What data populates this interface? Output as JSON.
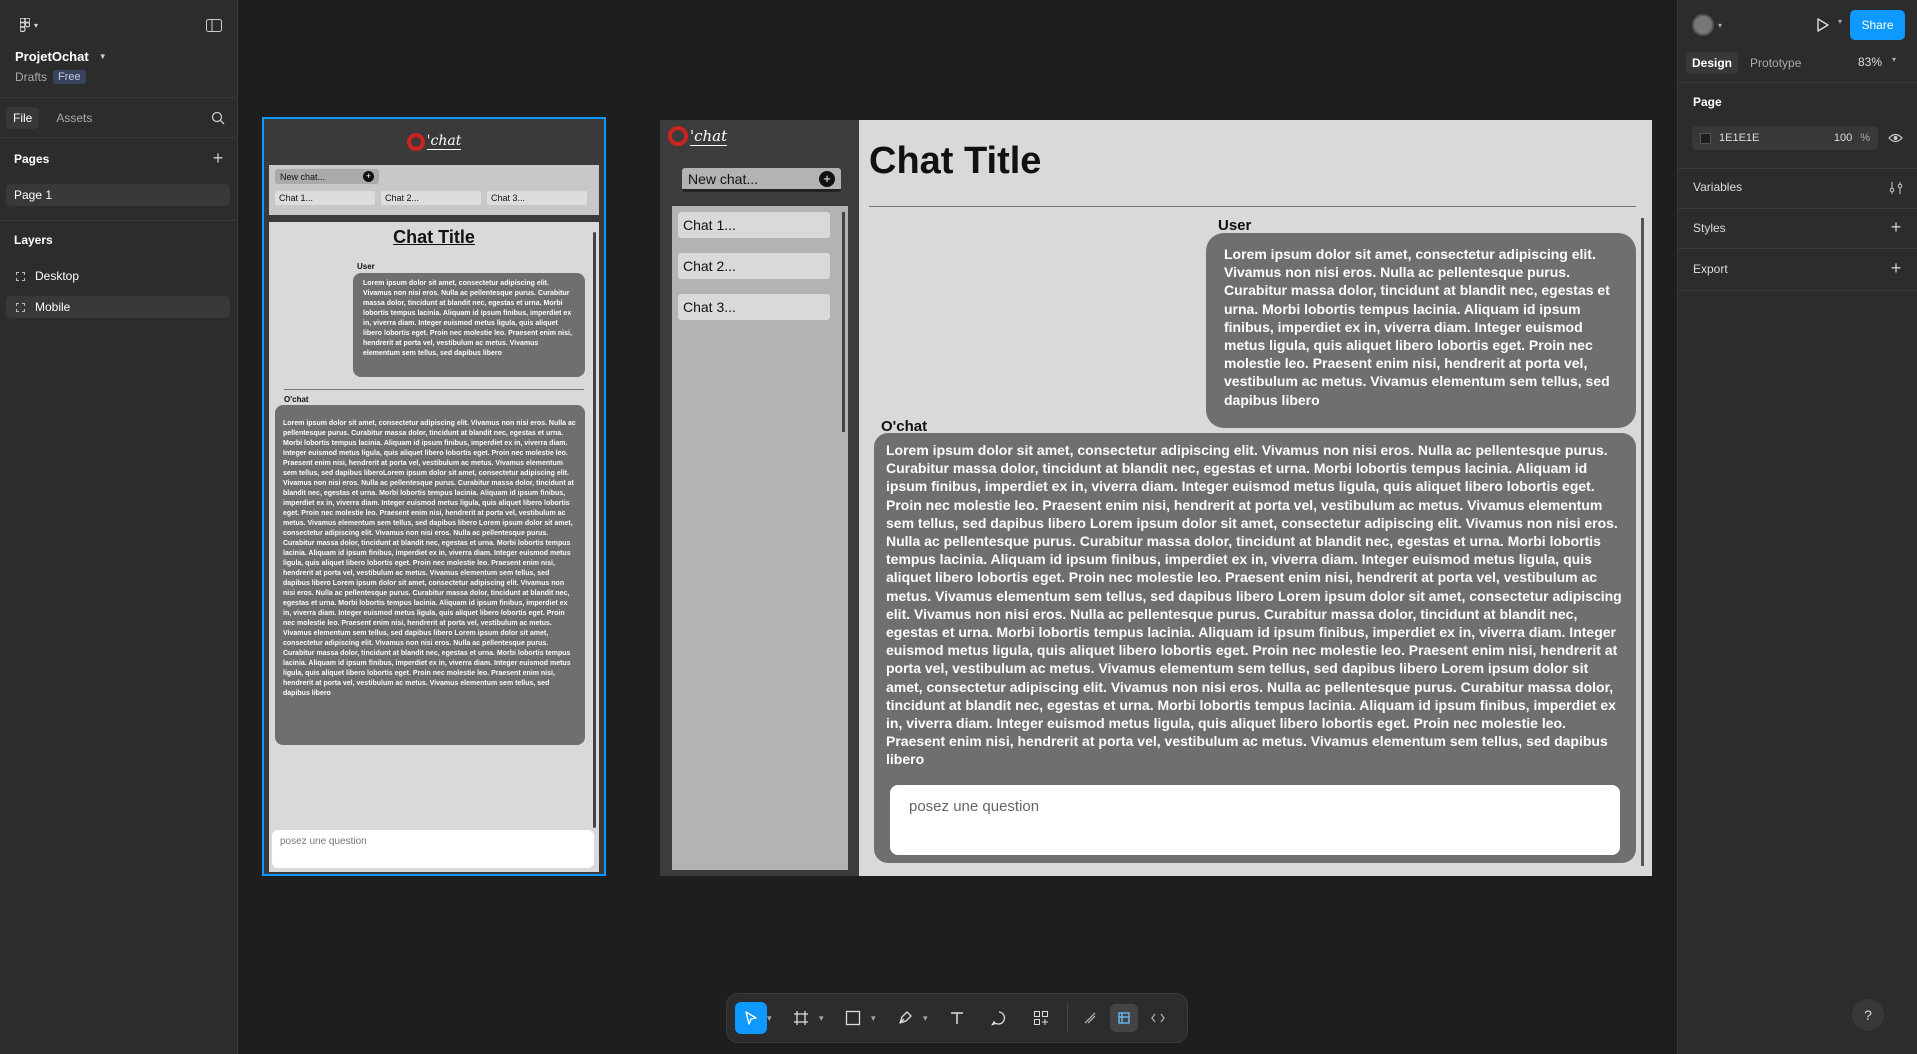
{
  "left_panel": {
    "project_name": "ProjetOchat",
    "drafts_label": "Drafts",
    "plan_badge": "Free",
    "tabs": {
      "file": "File",
      "assets": "Assets"
    },
    "pages_title": "Pages",
    "page_item": "Page 1",
    "layers_title": "Layers",
    "layers": [
      "Desktop",
      "Mobile"
    ]
  },
  "right_panel": {
    "tab_design": "Design",
    "tab_prototype": "Prototype",
    "zoom": "83%",
    "share_label": "Share",
    "page_section": "Page",
    "bg_color_hex": "1E1E1E",
    "bg_opacity": "100",
    "percent": "%",
    "variables": "Variables",
    "styles": "Styles",
    "export": "Export"
  },
  "mobile": {
    "logo_text": "'chat",
    "new_chat": "New chat...",
    "chats": [
      "Chat 1...",
      "Chat 2...",
      "Chat 3..."
    ],
    "chat_title": "Chat Title",
    "user_label": "User",
    "user_msg": "Lorem ipsum dolor sit amet, consectetur adipiscing elit. Vivamus non  nisi eros. Nulla ac pellentesque purus. Curabitur massa dolor, tincidunt at blandit nec, egestas et urna. Morbi lobortis tempus lacinia. Aliquam id ipsum finibus, imperdiet ex in, viverra diam. Integer euismod metus  ligula, quis aliquet libero lobortis eget. Proin nec molestie leo.  Praesent enim nisi, hendrerit at porta vel, vestibulum ac metus. Vivamus elementum sem tellus, sed dapibus libero",
    "bot_label": "O'chat",
    "bot_msg": "Lorem ipsum dolor sit amet, consectetur adipiscing elit. Vivamus non  nisi eros. Nulla ac pellentesque purus. Curabitur massa dolor, tincidunt at blandit nec, egestas et urna. Morbi lobortis tempus lacinia. Aliquam id ipsum finibus, imperdiet ex in, viverra diam. Integer euismod metus  ligula, quis aliquet libero lobortis eget. Proin nec molestie leo.  Praesent enim nisi, hendrerit at porta vel, vestibulum ac metus. Vivamus elementum sem tellus, sed dapibus liberoLorem ipsum dolor sit amet, consectetur adipiscing elit. Vivamus non  nisi eros. Nulla ac pellentesque purus. Curabitur massa dolor, tincidunt at blandit nec, egestas et urna. Morbi lobortis tempus lacinia. Aliquam id ipsum finibus, imperdiet ex in, viverra diam. Integer euismod metus  ligula, quis aliquet libero lobortis eget. Proin nec molestie leo.  Praesent enim nisi, hendrerit at porta vel, vestibulum ac metus. Vivamus elementum sem tellus, sed dapibus libero Lorem ipsum dolor sit amet, consectetur adipiscing elit. Vivamus non  nisi eros. Nulla ac pellentesque purus. Curabitur massa dolor, tincidunt at blandit nec, egestas et urna. Morbi lobortis tempus lacinia. Aliquam id ipsum finibus, imperdiet ex in, viverra diam. Integer euismod metus  ligula, quis aliquet libero lobortis eget. Proin nec molestie leo.  Praesent enim nisi, hendrerit at porta vel, vestibulum ac metus. Vivamus elementum sem tellus, sed dapibus libero Lorem ipsum dolor sit amet, consectetur adipiscing elit. Vivamus non  nisi eros. Nulla ac pellentesque purus. Curabitur massa dolor, tincidunt at blandit nec, egestas et urna. Morbi lobortis tempus lacinia. Aliquam id ipsum finibus, imperdiet ex in, viverra diam. Integer euismod metus  ligula, quis aliquet libero lobortis eget. Proin nec molestie leo.  Praesent enim nisi, hendrerit at porta vel, vestibulum ac metus. Vivamus elementum sem tellus, sed dapibus libero Lorem ipsum dolor sit amet, consectetur adipiscing elit. Vivamus non  nisi eros. Nulla ac pellentesque purus. Curabitur massa dolor, tincidunt at blandit nec, egestas et urna. Morbi lobortis tempus lacinia. Aliquam id ipsum finibus, imperdiet ex in, viverra diam. Integer euismod metus  ligula, quis aliquet libero lobortis eget. Proin nec molestie leo.  Praesent enim nisi, hendrerit at porta vel, vestibulum ac metus. Vivamus elementum sem tellus, sed dapibus libero",
    "input_placeholder": "posez une question"
  },
  "desktop": {
    "logo_text": "'chat",
    "new_chat": "New chat...",
    "chats": [
      "Chat 1...",
      "Chat 2...",
      "Chat 3..."
    ],
    "chat_title": "Chat Title",
    "user_label": "User",
    "user_msg": "Lorem ipsum dolor sit amet, consectetur adipiscing elit. Vivamus non  nisi eros. Nulla ac pellentesque purus. Curabitur massa dolor, tincidunt at blandit nec, egestas et urna. Morbi lobortis tempus lacinia. Aliquam id ipsum finibus, imperdiet ex in, viverra diam. Integer euismod metus  ligula, quis aliquet libero lobortis eget. Proin nec molestie leo.  Praesent enim nisi, hendrerit at porta vel, vestibulum ac metus. Vivamus elementum sem tellus, sed dapibus libero",
    "bot_label": "O'chat",
    "bot_msg": "Lorem ipsum dolor sit amet, consectetur adipiscing elit. Vivamus non  nisi eros. Nulla ac pellentesque purus. Curabitur massa dolor, tincidunt at blandit nec, egestas et urna. Morbi lobortis tempus lacinia. Aliquam id ipsum finibus, imperdiet ex in, viverra diam. Integer euismod metus  ligula, quis aliquet libero lobortis eget. Proin nec molestie leo.  Praesent enim nisi, hendrerit at porta vel, vestibulum ac metus. Vivamus elementum sem tellus, sed dapibus libero Lorem ipsum dolor sit amet, consectetur adipiscing elit. Vivamus non  nisi eros. Nulla ac pellentesque purus. Curabitur massa dolor, tincidunt at blandit nec, egestas et urna. Morbi lobortis tempus lacinia. Aliquam id ipsum finibus, imperdiet ex in, viverra diam. Integer euismod metus  ligula, quis aliquet libero lobortis eget. Proin nec molestie leo.  Praesent enim nisi, hendrerit at porta vel, vestibulum ac metus. Vivamus elementum sem tellus, sed dapibus libero Lorem ipsum dolor sit amet, consectetur adipiscing elit. Vivamus non  nisi eros. Nulla ac pellentesque purus. Curabitur massa dolor, tincidunt at blandit nec, egestas et urna. Morbi lobortis tempus lacinia. Aliquam id ipsum finibus, imperdiet ex in, viverra diam. Integer euismod metus  ligula, quis aliquet libero lobortis eget. Proin nec molestie leo.  Praesent enim nisi, hendrerit at porta vel, vestibulum ac metus. Vivamus elementum sem tellus, sed dapibus libero Lorem ipsum dolor sit amet, consectetur adipiscing elit. Vivamus non  nisi eros. Nulla ac pellentesque purus. Curabitur massa dolor, tincidunt at blandit nec, egestas et urna. Morbi lobortis tempus lacinia. Aliquam id ipsum finibus, imperdiet ex in, viverra diam. Integer euismod metus  ligula, quis aliquet libero lobortis eget. Proin nec molestie leo.  Praesent enim nisi, hendrerit at porta vel, vestibulum ac metus. Vivamus elementum sem tellus, sed dapibus libero",
    "input_placeholder": "posez une question"
  },
  "help": "?",
  "colors": {
    "accent": "#0d99ff",
    "canvas": "#1e1e1e",
    "panel": "#2c2c2c",
    "logo_red": "#cc2222"
  }
}
